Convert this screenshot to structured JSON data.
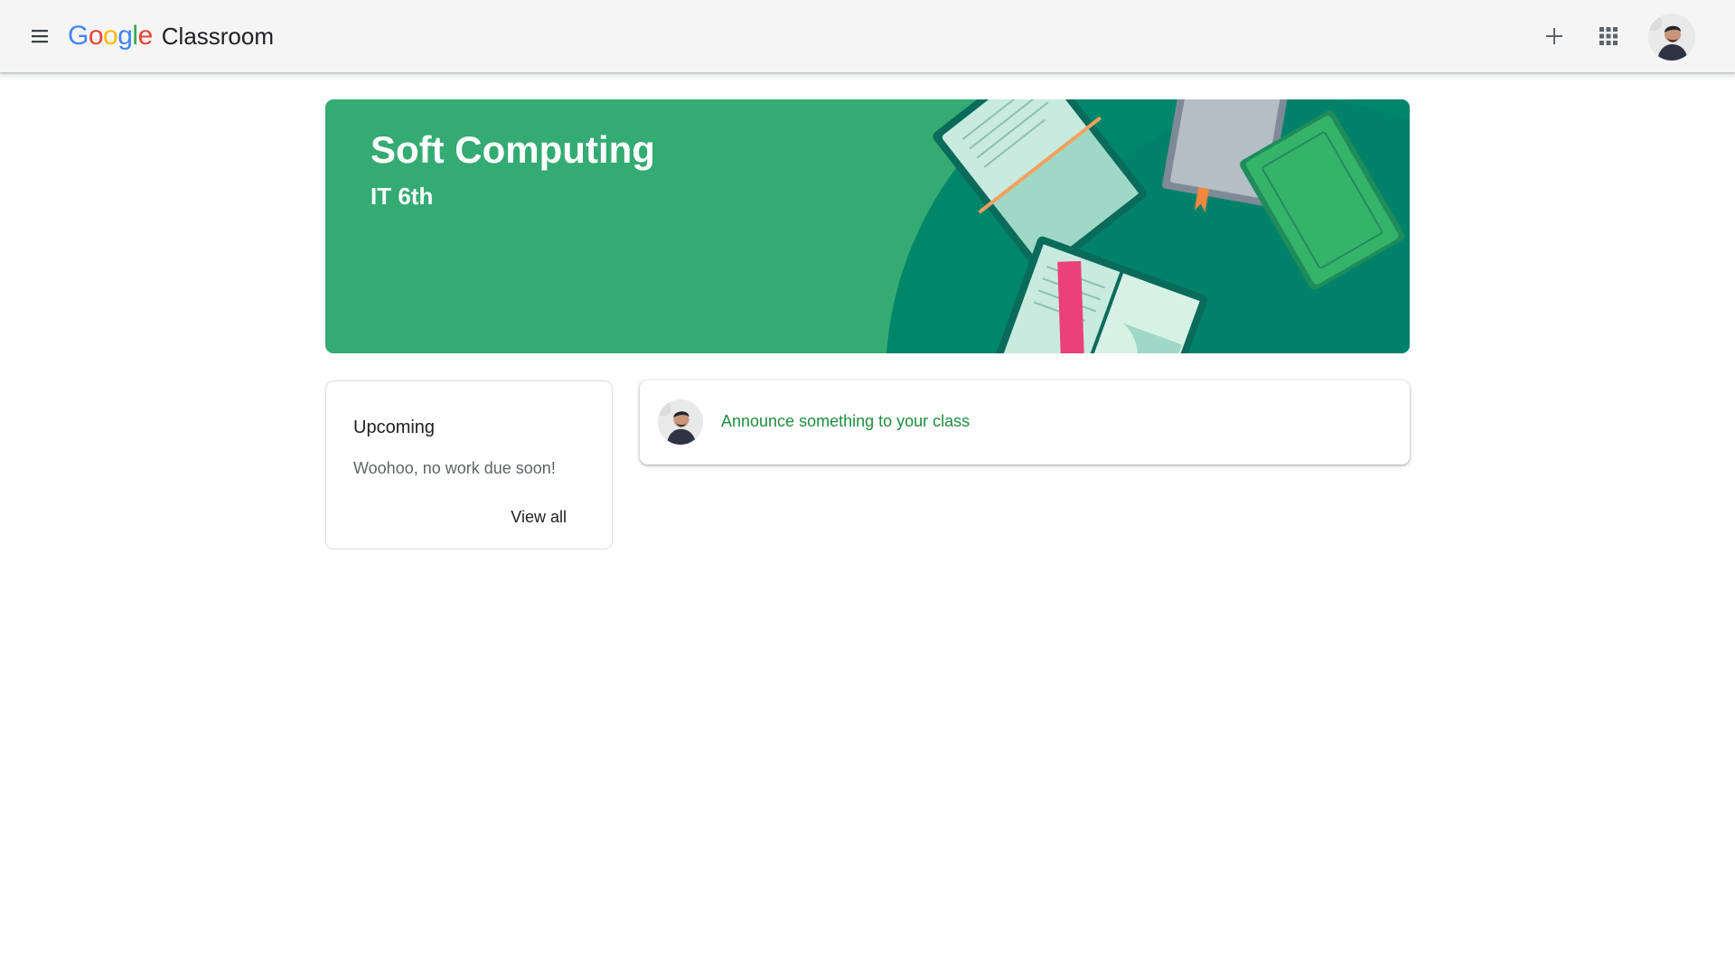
{
  "topbar": {
    "menu_icon": "hamburger-menu-icon",
    "brand_letters": [
      "G",
      "o",
      "o",
      "g",
      "l",
      "e"
    ],
    "brand_letter_colors": [
      "#4285f4",
      "#ea4335",
      "#fbbc05",
      "#4285f4",
      "#34a853",
      "#ea4335"
    ],
    "product_name": "Classroom",
    "add_icon": "plus-icon",
    "apps_icon": "apps-grid-icon",
    "account_avatar": "user-avatar"
  },
  "banner": {
    "class_name": "Soft Computing",
    "section": "IT 6th",
    "theme_color": "#34ab72",
    "illustration": "books-illustration"
  },
  "upcoming": {
    "title": "Upcoming",
    "empty_message": "Woohoo, no work due soon!",
    "view_all_label": "View all"
  },
  "stream": {
    "announce_placeholder": "Announce something to your class",
    "accent_color": "#1e8e3e"
  }
}
